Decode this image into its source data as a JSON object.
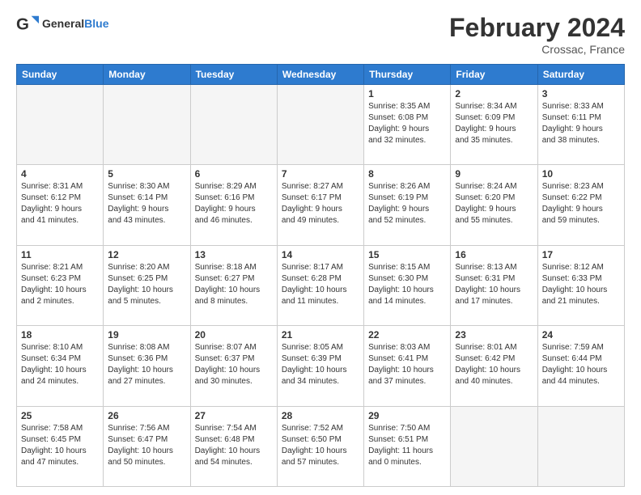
{
  "logo": {
    "text1": "General",
    "text2": "Blue"
  },
  "title": "February 2024",
  "location": "Crossac, France",
  "days_header": [
    "Sunday",
    "Monday",
    "Tuesday",
    "Wednesday",
    "Thursday",
    "Friday",
    "Saturday"
  ],
  "weeks": [
    [
      {
        "num": "",
        "text": "",
        "empty": true
      },
      {
        "num": "",
        "text": "",
        "empty": true
      },
      {
        "num": "",
        "text": "",
        "empty": true
      },
      {
        "num": "",
        "text": "",
        "empty": true
      },
      {
        "num": "1",
        "text": "Sunrise: 8:35 AM\nSunset: 6:08 PM\nDaylight: 9 hours\nand 32 minutes.",
        "empty": false
      },
      {
        "num": "2",
        "text": "Sunrise: 8:34 AM\nSunset: 6:09 PM\nDaylight: 9 hours\nand 35 minutes.",
        "empty": false
      },
      {
        "num": "3",
        "text": "Sunrise: 8:33 AM\nSunset: 6:11 PM\nDaylight: 9 hours\nand 38 minutes.",
        "empty": false
      }
    ],
    [
      {
        "num": "4",
        "text": "Sunrise: 8:31 AM\nSunset: 6:12 PM\nDaylight: 9 hours\nand 41 minutes.",
        "empty": false
      },
      {
        "num": "5",
        "text": "Sunrise: 8:30 AM\nSunset: 6:14 PM\nDaylight: 9 hours\nand 43 minutes.",
        "empty": false
      },
      {
        "num": "6",
        "text": "Sunrise: 8:29 AM\nSunset: 6:16 PM\nDaylight: 9 hours\nand 46 minutes.",
        "empty": false
      },
      {
        "num": "7",
        "text": "Sunrise: 8:27 AM\nSunset: 6:17 PM\nDaylight: 9 hours\nand 49 minutes.",
        "empty": false
      },
      {
        "num": "8",
        "text": "Sunrise: 8:26 AM\nSunset: 6:19 PM\nDaylight: 9 hours\nand 52 minutes.",
        "empty": false
      },
      {
        "num": "9",
        "text": "Sunrise: 8:24 AM\nSunset: 6:20 PM\nDaylight: 9 hours\nand 55 minutes.",
        "empty": false
      },
      {
        "num": "10",
        "text": "Sunrise: 8:23 AM\nSunset: 6:22 PM\nDaylight: 9 hours\nand 59 minutes.",
        "empty": false
      }
    ],
    [
      {
        "num": "11",
        "text": "Sunrise: 8:21 AM\nSunset: 6:23 PM\nDaylight: 10 hours\nand 2 minutes.",
        "empty": false
      },
      {
        "num": "12",
        "text": "Sunrise: 8:20 AM\nSunset: 6:25 PM\nDaylight: 10 hours\nand 5 minutes.",
        "empty": false
      },
      {
        "num": "13",
        "text": "Sunrise: 8:18 AM\nSunset: 6:27 PM\nDaylight: 10 hours\nand 8 minutes.",
        "empty": false
      },
      {
        "num": "14",
        "text": "Sunrise: 8:17 AM\nSunset: 6:28 PM\nDaylight: 10 hours\nand 11 minutes.",
        "empty": false
      },
      {
        "num": "15",
        "text": "Sunrise: 8:15 AM\nSunset: 6:30 PM\nDaylight: 10 hours\nand 14 minutes.",
        "empty": false
      },
      {
        "num": "16",
        "text": "Sunrise: 8:13 AM\nSunset: 6:31 PM\nDaylight: 10 hours\nand 17 minutes.",
        "empty": false
      },
      {
        "num": "17",
        "text": "Sunrise: 8:12 AM\nSunset: 6:33 PM\nDaylight: 10 hours\nand 21 minutes.",
        "empty": false
      }
    ],
    [
      {
        "num": "18",
        "text": "Sunrise: 8:10 AM\nSunset: 6:34 PM\nDaylight: 10 hours\nand 24 minutes.",
        "empty": false
      },
      {
        "num": "19",
        "text": "Sunrise: 8:08 AM\nSunset: 6:36 PM\nDaylight: 10 hours\nand 27 minutes.",
        "empty": false
      },
      {
        "num": "20",
        "text": "Sunrise: 8:07 AM\nSunset: 6:37 PM\nDaylight: 10 hours\nand 30 minutes.",
        "empty": false
      },
      {
        "num": "21",
        "text": "Sunrise: 8:05 AM\nSunset: 6:39 PM\nDaylight: 10 hours\nand 34 minutes.",
        "empty": false
      },
      {
        "num": "22",
        "text": "Sunrise: 8:03 AM\nSunset: 6:41 PM\nDaylight: 10 hours\nand 37 minutes.",
        "empty": false
      },
      {
        "num": "23",
        "text": "Sunrise: 8:01 AM\nSunset: 6:42 PM\nDaylight: 10 hours\nand 40 minutes.",
        "empty": false
      },
      {
        "num": "24",
        "text": "Sunrise: 7:59 AM\nSunset: 6:44 PM\nDaylight: 10 hours\nand 44 minutes.",
        "empty": false
      }
    ],
    [
      {
        "num": "25",
        "text": "Sunrise: 7:58 AM\nSunset: 6:45 PM\nDaylight: 10 hours\nand 47 minutes.",
        "empty": false
      },
      {
        "num": "26",
        "text": "Sunrise: 7:56 AM\nSunset: 6:47 PM\nDaylight: 10 hours\nand 50 minutes.",
        "empty": false
      },
      {
        "num": "27",
        "text": "Sunrise: 7:54 AM\nSunset: 6:48 PM\nDaylight: 10 hours\nand 54 minutes.",
        "empty": false
      },
      {
        "num": "28",
        "text": "Sunrise: 7:52 AM\nSunset: 6:50 PM\nDaylight: 10 hours\nand 57 minutes.",
        "empty": false
      },
      {
        "num": "29",
        "text": "Sunrise: 7:50 AM\nSunset: 6:51 PM\nDaylight: 11 hours\nand 0 minutes.",
        "empty": false
      },
      {
        "num": "",
        "text": "",
        "empty": true
      },
      {
        "num": "",
        "text": "",
        "empty": true
      }
    ]
  ]
}
